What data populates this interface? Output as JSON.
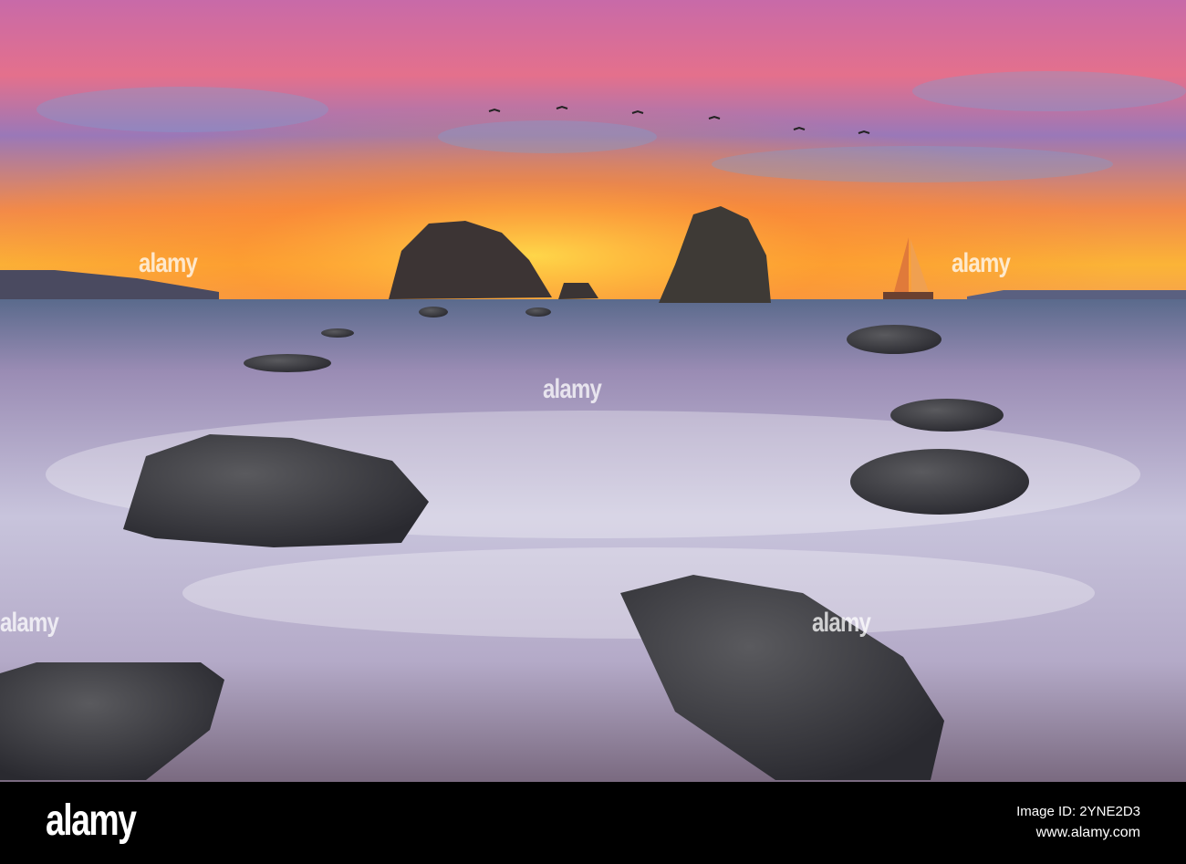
{
  "watermark": "alamy",
  "footer": {
    "logo": "alamy",
    "image_id": "Image ID: 2YNE2D3",
    "website": "www.alamy.com"
  }
}
